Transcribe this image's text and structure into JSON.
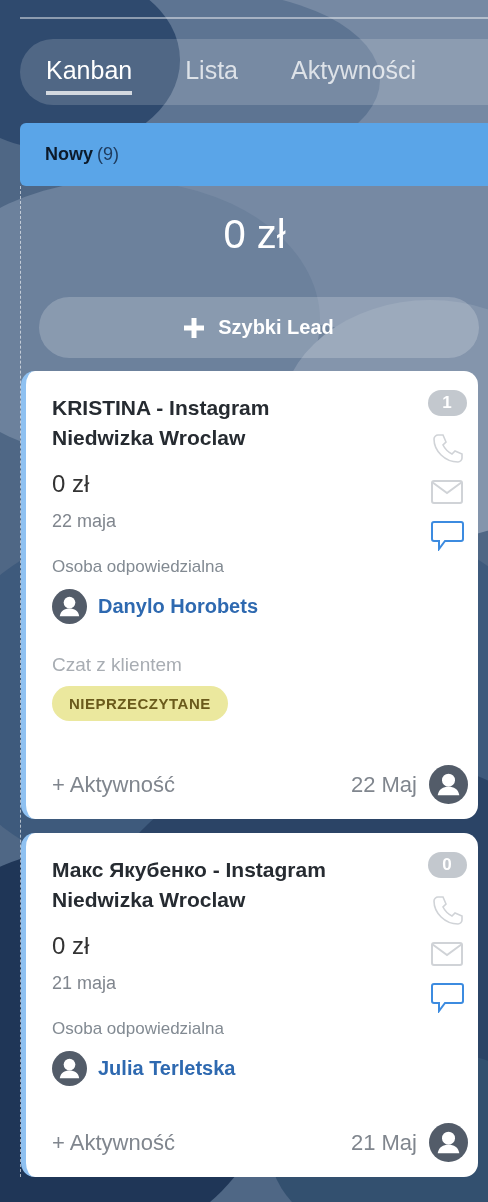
{
  "tabs": [
    {
      "label": "Kanban",
      "selected": true
    },
    {
      "label": "Lista",
      "selected": false
    },
    {
      "label": "Aktywności",
      "selected": false
    }
  ],
  "column": {
    "name": "Nowy",
    "count": "(9)",
    "total": "0 zł",
    "quick_button": "Szybki Lead"
  },
  "cards": [
    {
      "title": "KRISTINA - Instagram Niedwizka Wroclaw",
      "badge": "1",
      "amount": "0 zł",
      "date": "22 maja",
      "responsible_label": "Osoba odpowiedzialna",
      "responsible": "Danylo Horobets",
      "chat_label": "Czat z klientem",
      "chat_status": "NIEPRZECZYTANE",
      "activity_button": "+ Aktywność",
      "footer_date": "22 Maj"
    },
    {
      "title": "Макс Якубенко - Instagram Niedwizka Wroclaw",
      "badge": "0",
      "amount": "0 zł",
      "date": "21 maja",
      "responsible_label": "Osoba odpowiedzialna",
      "responsible": "Julia Terletska",
      "activity_button": "+ Aktywność",
      "footer_date": "21 Maj"
    }
  ]
}
